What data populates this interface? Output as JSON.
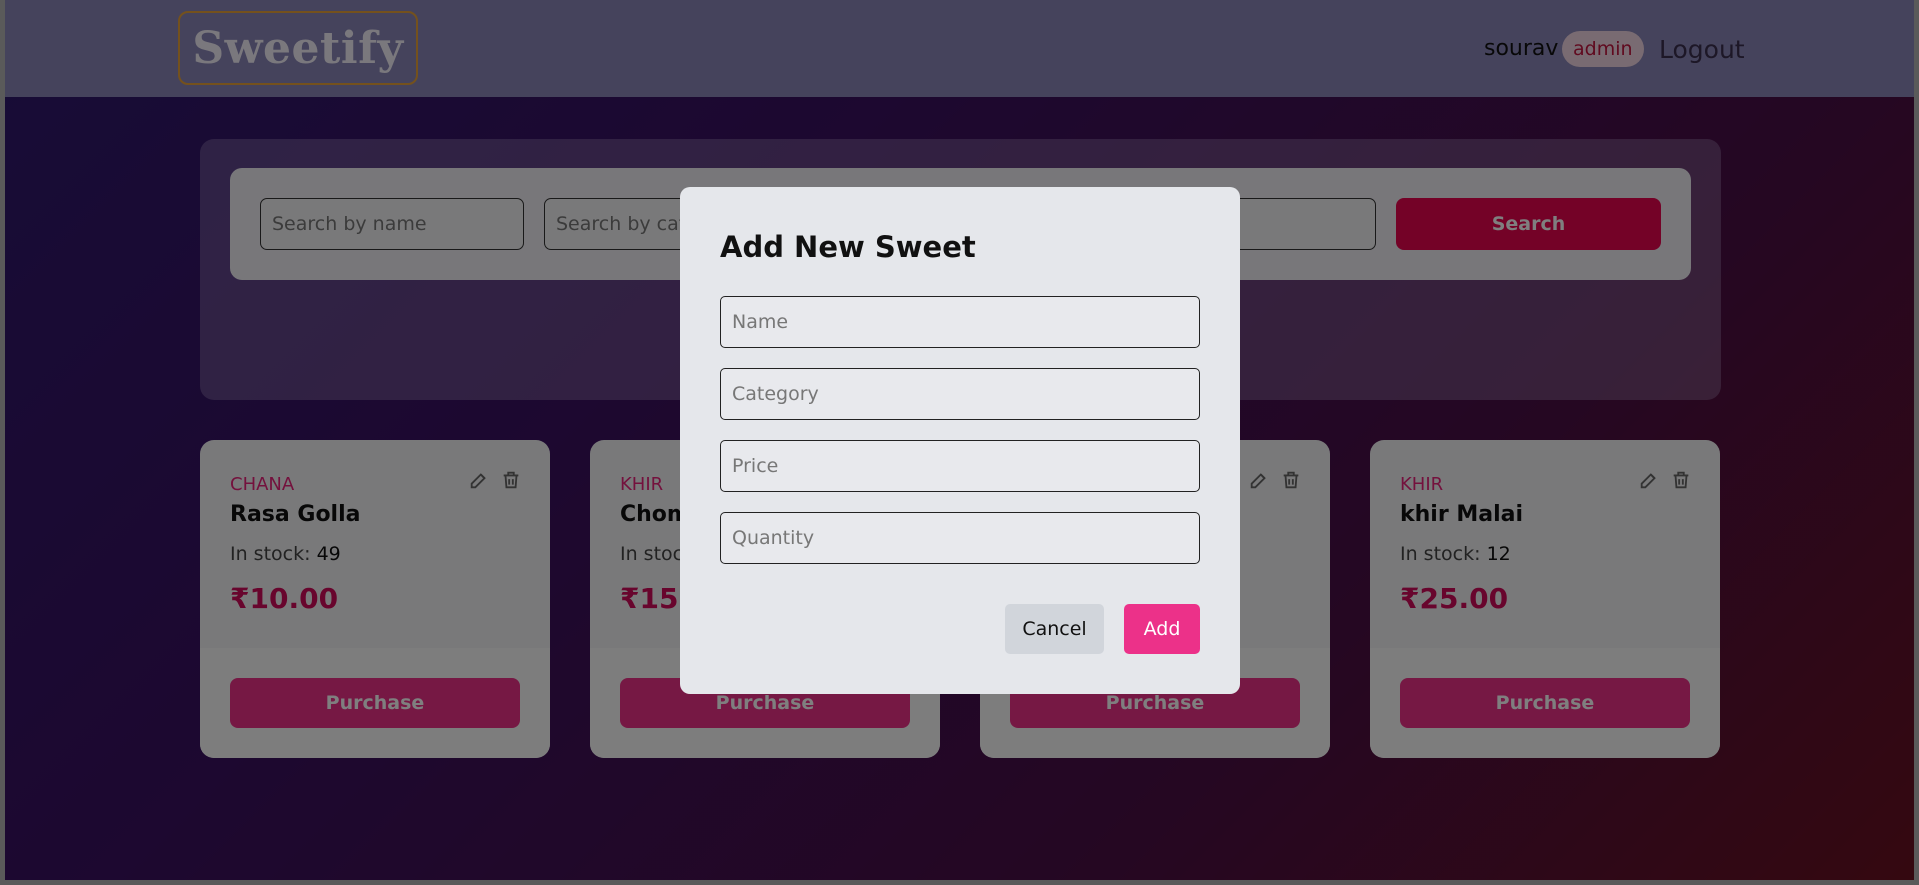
{
  "header": {
    "logo_text": "Sweetify",
    "username": "sourav",
    "role": "admin",
    "logout_label": "Logout"
  },
  "search": {
    "name_placeholder": "Search by name",
    "category_placeholder": "Search by category",
    "search_label": "Search"
  },
  "cards": [
    {
      "category": "CHANA",
      "name": "Rasa Golla",
      "stock_label": "In stock:",
      "stock": "49",
      "price": "₹10.00",
      "purchase_label": "Purchase"
    },
    {
      "category": "KHIR",
      "name": "Chom",
      "stock_label": "In stoc",
      "stock": "",
      "price": "₹15.",
      "purchase_label": "Purchase"
    },
    {
      "category": "",
      "name": "",
      "stock_label": "",
      "stock": "",
      "price": "",
      "purchase_label": "Purchase"
    },
    {
      "category": "KHIR",
      "name": "khir Malai",
      "stock_label": "In stock:",
      "stock": "12",
      "price": "₹25.00",
      "purchase_label": "Purchase"
    }
  ],
  "modal": {
    "title": "Add New Sweet",
    "name_placeholder": "Name",
    "category_placeholder": "Category",
    "price_placeholder": "Price",
    "quantity_placeholder": "Quantity",
    "cancel_label": "Cancel",
    "add_label": "Add"
  },
  "colors": {
    "accent_pink": "#ec3189",
    "search_red": "#e8054e",
    "category_pink": "#e8237a",
    "price_pink": "#d10a5a",
    "logo_border": "#e8a23a"
  },
  "icons": {
    "edit": "pencil-square-icon",
    "delete": "trash-icon"
  }
}
